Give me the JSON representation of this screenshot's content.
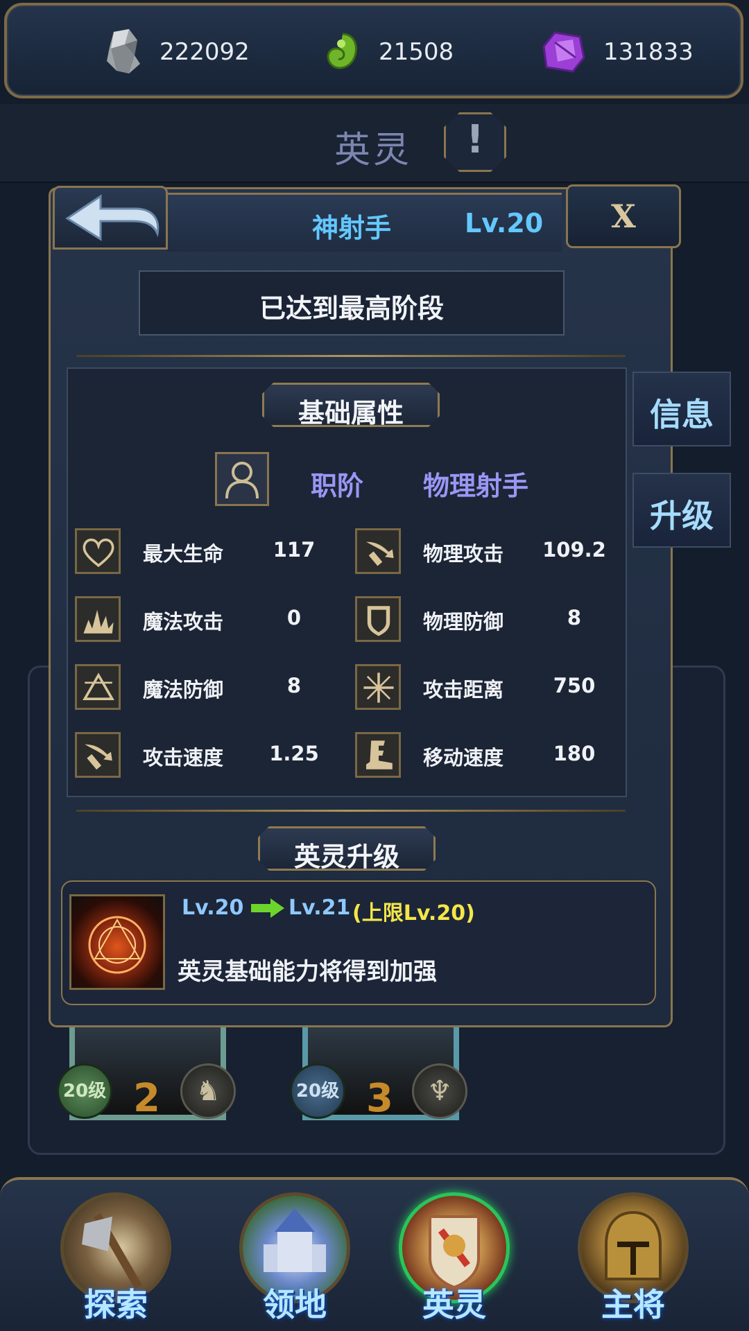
{
  "resources": [
    {
      "icon": "stone-ore-icon",
      "value": "222092"
    },
    {
      "icon": "green-essence-icon",
      "value": "21508"
    },
    {
      "icon": "purple-crystal-icon",
      "value": "131833"
    }
  ],
  "page": {
    "title": "英灵",
    "alert_symbol": "!"
  },
  "panel": {
    "hero_name": "神射手",
    "hero_level": "Lv.20",
    "close_label": "X",
    "stage_status": "已达到最高阶段",
    "section_basic": "基础属性",
    "class_label": "职阶",
    "class_value": "物理射手",
    "stats": [
      {
        "icon": "heart-icon",
        "label": "最大生命",
        "value": "117"
      },
      {
        "icon": "sword-icon",
        "label": "物理攻击",
        "value": "109.2"
      },
      {
        "icon": "magic-burst-icon",
        "label": "魔法攻击",
        "value": "0"
      },
      {
        "icon": "shield-icon",
        "label": "物理防御",
        "value": "8"
      },
      {
        "icon": "magic-triangle-icon",
        "label": "魔法防御",
        "value": "8"
      },
      {
        "icon": "crosshair-range-icon",
        "label": "攻击距离",
        "value": "750"
      },
      {
        "icon": "sword-speed-icon",
        "label": "攻击速度",
        "value": "1.25"
      },
      {
        "icon": "boot-icon",
        "label": "移动速度",
        "value": "180"
      }
    ],
    "section_upgrade": "英灵升级",
    "upgrade": {
      "from": "Lv.20",
      "to": "Lv.21",
      "cap": "(上限Lv.20)",
      "description": "英灵基础能力将得到加强"
    }
  },
  "side_tabs": {
    "info": "信息",
    "upgrade": "升级"
  },
  "background_cards": [
    {
      "level": "20级",
      "rank": "2",
      "icon": "horse-head-icon"
    },
    {
      "level": "20级",
      "rank": "3",
      "icon": "flame-crest-icon"
    }
  ],
  "nav": {
    "items": [
      {
        "label": "探索",
        "icon": "axe-shield-icon",
        "active": false
      },
      {
        "label": "领地",
        "icon": "castle-icon",
        "active": false
      },
      {
        "label": "英灵",
        "icon": "lion-crest-icon",
        "active": true
      },
      {
        "label": "主将",
        "icon": "knight-helmet-icon",
        "active": false
      }
    ]
  },
  "colors": {
    "gold_border": "#8a7550",
    "hero_name": "#63c8ff",
    "class_text": "#9a96f4",
    "cap_text": "#f4e64a",
    "active_nav": "#29c55a"
  }
}
